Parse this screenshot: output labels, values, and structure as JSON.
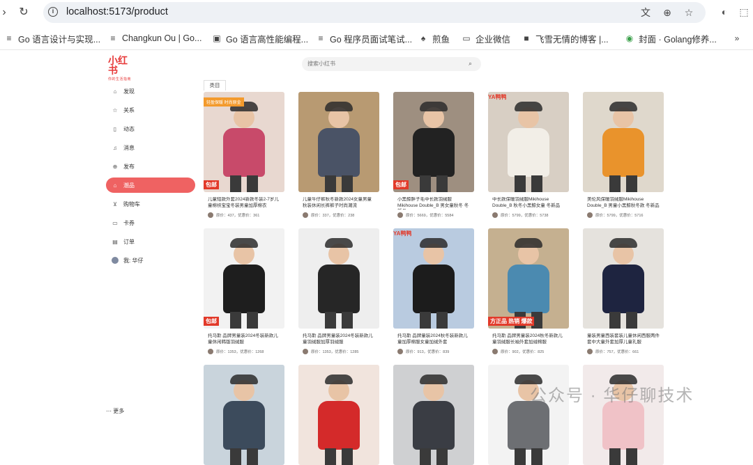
{
  "browser": {
    "url": "localhost:5173/product",
    "bookmarks": [
      "Go 语言设计与实现...",
      "Changkun Ou | Go...",
      "Go 语言高性能编程...",
      "Go 程序员面试笔试...",
      "煎鱼",
      "企业微信",
      "飞雪无情的博客 |...",
      "封面 · Golang修养..."
    ]
  },
  "app": {
    "logo": "小红书",
    "logo_sub": "你的生活指南",
    "search_placeholder": "搜索小红书",
    "category_tab": "类目",
    "more": "更多"
  },
  "sidebar": [
    {
      "label": "发现",
      "icon": "home-icon"
    },
    {
      "label": "关系",
      "icon": "star-icon"
    },
    {
      "label": "动态",
      "icon": "activity-icon"
    },
    {
      "label": "消息",
      "icon": "bell-icon"
    },
    {
      "label": "发布",
      "icon": "plus-circle-icon"
    },
    {
      "label": "潮品",
      "icon": "product-icon",
      "active": true
    },
    {
      "label": "购物车",
      "icon": "cart-icon"
    },
    {
      "label": "卡券",
      "icon": "coupon-icon"
    },
    {
      "label": "订单",
      "icon": "order-icon"
    },
    {
      "label": "我: 华仔",
      "icon": "avatar"
    }
  ],
  "products": [
    {
      "title": "儿童短款外套2024新款冬装2-7岁儿童棉袄宝宝冬装男童加厚棉衣",
      "price": "原价：437，优惠价：361",
      "tag_orange": "轻盈保暖 时尚原金",
      "tag_red": "包邮",
      "colors": [
        "#e8d8d0",
        "#c84a6a"
      ]
    },
    {
      "title": "儿童牛仔裤秋冬新款2024女童男童秋装休闲长裤裤子时尚潮流",
      "price": "原价：337，优惠价：238",
      "colors": [
        "#b89a72",
        "#4a5366"
      ]
    },
    {
      "title": "小黑鲸胖子毛中长款羽绒服Mikihouse Double_B 男女童秋冬 冬新品",
      "price": "原价：5669，优惠价：5584",
      "tag_red": "包邮",
      "colors": [
        "#9e8f80",
        "#222222"
      ]
    },
    {
      "title": "中长款保暖羽绒服Mikihouse Double_B 秋冬小黑鲸女童 冬新品",
      "price": "原价：5799，优惠价：5738",
      "tag_brand": "YA鸭鸭",
      "colors": [
        "#d8cfc4",
        "#f2eee7"
      ]
    },
    {
      "title": "美伦风保暖羽绒服Mikihouse Double_B 男童小黑鲸秋冬款 冬新品",
      "price": "原价：5799，优惠价：5716",
      "colors": [
        "#dfd8cc",
        "#e9932c"
      ]
    },
    {
      "title": "托马斯 品牌男童装2024冬装新款儿童休闲韩版羽绒服",
      "price": "原价：1353，优惠价：1268",
      "tag_red": "包邮",
      "colors": [
        "#f2f2f2",
        "#1e1e1e"
      ]
    },
    {
      "title": "托马斯 品牌男童装2024冬装新款儿童羽绒服加厚羽绒服",
      "price": "原价：1353，优惠价：1285",
      "colors": [
        "#eeeeee",
        "#262626"
      ]
    },
    {
      "title": "托马斯 品牌童装2024秋冬装新款儿童加厚棉服女童加绒外套",
      "price": "原价：913，优惠价：839",
      "tag_brand": "YA鸭鸭",
      "colors": [
        "#b9cbe0",
        "#1c1c1c"
      ]
    },
    {
      "title": "托马斯 品牌男童装2024秋冬新款儿童羽绒服长袖外套加绒棉服",
      "price": "原价：902，优惠价：825",
      "tag_red": "方正品 热销 爆款",
      "colors": [
        "#c5b090",
        "#4b8ab0"
      ]
    },
    {
      "title": "童装男童西装套装儿童休闲西服两件套中大童外套加厚儿童礼服",
      "price": "原价：757，优惠价：661",
      "colors": [
        "#e5e2dd",
        "#1e2440"
      ]
    },
    {
      "title": "",
      "price": "",
      "colors": [
        "#c9d4dc",
        "#3c4b5c"
      ]
    },
    {
      "title": "",
      "price": "",
      "colors": [
        "#f1e4dd",
        "#d42a2a"
      ]
    },
    {
      "title": "",
      "price": "",
      "colors": [
        "#cfd0d2",
        "#3a3d44"
      ]
    },
    {
      "title": "",
      "price": "",
      "colors": [
        "#f3f3f3",
        "#6d6f73"
      ]
    },
    {
      "title": "",
      "price": "",
      "colors": [
        "#f2eaea",
        "#f0c2c7"
      ]
    }
  ],
  "watermark": "公众号 · 华仔聊技术"
}
